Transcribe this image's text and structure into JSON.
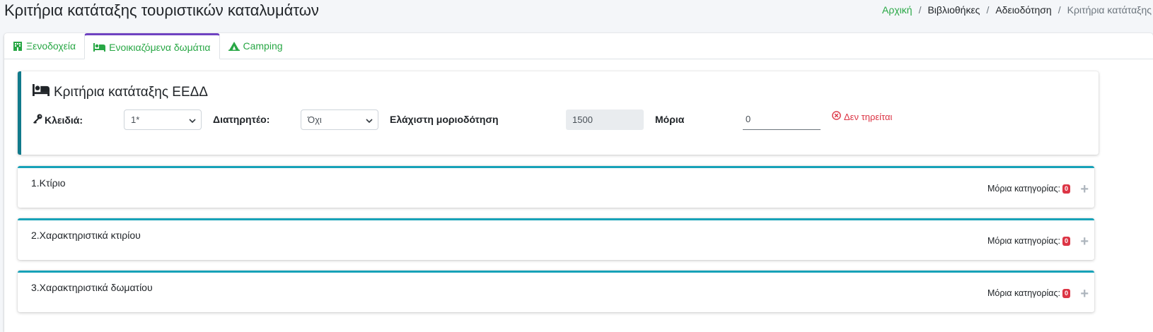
{
  "page": {
    "title": "Κριτήρια κατάταξης τουριστικών καταλυμάτων"
  },
  "breadcrumb": {
    "home": "Αρχική",
    "items": [
      "Βιβλιοθήκες",
      "Αδειοδότηση"
    ],
    "active": "Κριτήρια κατάταξης",
    "separator": "/"
  },
  "tabs": [
    {
      "label": "Ξενοδοχεία",
      "icon": "hotel-icon",
      "active": false
    },
    {
      "label": "Ενοικιαζόμενα δωμάτια",
      "icon": "bed-icon",
      "active": true
    },
    {
      "label": "Camping",
      "icon": "campground-icon",
      "active": false
    }
  ],
  "criteria": {
    "title": "Κριτήρια κατάταξης ΕΕΔΔ",
    "keys_label": "Κλειδιά:",
    "keys_value": "1*",
    "preserved_label": "Διατηρητέο:",
    "preserved_value": "Όχι",
    "min_score_label": "Ελάχιστη μοριοδότηση",
    "min_score_value": "1500",
    "points_label": "Μόρια",
    "points_value": "0",
    "status": "Δεν τηρείται"
  },
  "sections": [
    {
      "title": "1.Κτίριο",
      "points_label": "Μόρια κατηγορίας:",
      "points": "0"
    },
    {
      "title": "2.Χαρακτηριστικά κτιρίου",
      "points_label": "Μόρια κατηγορίας:",
      "points": "0"
    },
    {
      "title": "3.Χαρακτηριστικά δωματίου",
      "points_label": "Μόρια κατηγορίας:",
      "points": "0"
    }
  ],
  "colors": {
    "accent_green": "#28a745",
    "active_tab_border": "#6f42c1",
    "criteria_border": "#117a8b",
    "section_border": "#17a2b8",
    "danger": "#dc3545"
  }
}
